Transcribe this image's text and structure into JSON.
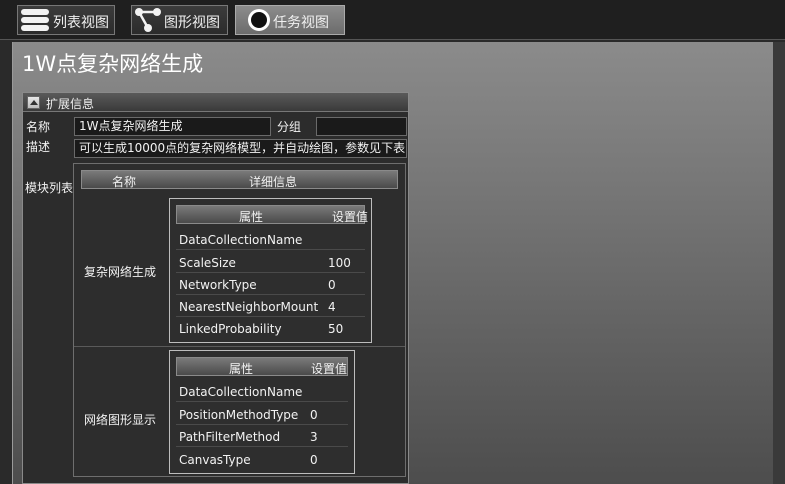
{
  "toolbar": {
    "buttons": [
      {
        "label": "列表视图",
        "icon": "list-icon",
        "active": false
      },
      {
        "label": "图形视图",
        "icon": "graph-icon",
        "active": false
      },
      {
        "label": "任务视图",
        "icon": "circle-icon",
        "active": true
      }
    ]
  },
  "page": {
    "title": "1W点复杂网络生成"
  },
  "expander": {
    "title": "扩展信息",
    "name_label": "名称",
    "name_value": "1W点复杂网络生成",
    "group_label": "分组",
    "group_value": "",
    "desc_label": "描述",
    "desc_value": "可以生成10000点的复杂网络模型，并自动绘图，参数见下表",
    "modules_label": "模块列表"
  },
  "module_table": {
    "col_name": "名称",
    "col_detail": "详细信息",
    "prop_header": "属性",
    "value_header": "设置值",
    "modules": [
      {
        "name": "复杂网络生成",
        "props": [
          {
            "key": "DataCollectionName",
            "value": ""
          },
          {
            "key": "ScaleSize",
            "value": "100"
          },
          {
            "key": "NetworkType",
            "value": "0"
          },
          {
            "key": "NearestNeighborMount",
            "value": "4"
          },
          {
            "key": "LinkedProbability",
            "value": "50"
          }
        ]
      },
      {
        "name": "网络图形显示",
        "props": [
          {
            "key": "DataCollectionName",
            "value": ""
          },
          {
            "key": "PositionMethodType",
            "value": "0"
          },
          {
            "key": "PathFilterMethod",
            "value": "3"
          },
          {
            "key": "CanvasType",
            "value": "0"
          }
        ]
      }
    ]
  }
}
